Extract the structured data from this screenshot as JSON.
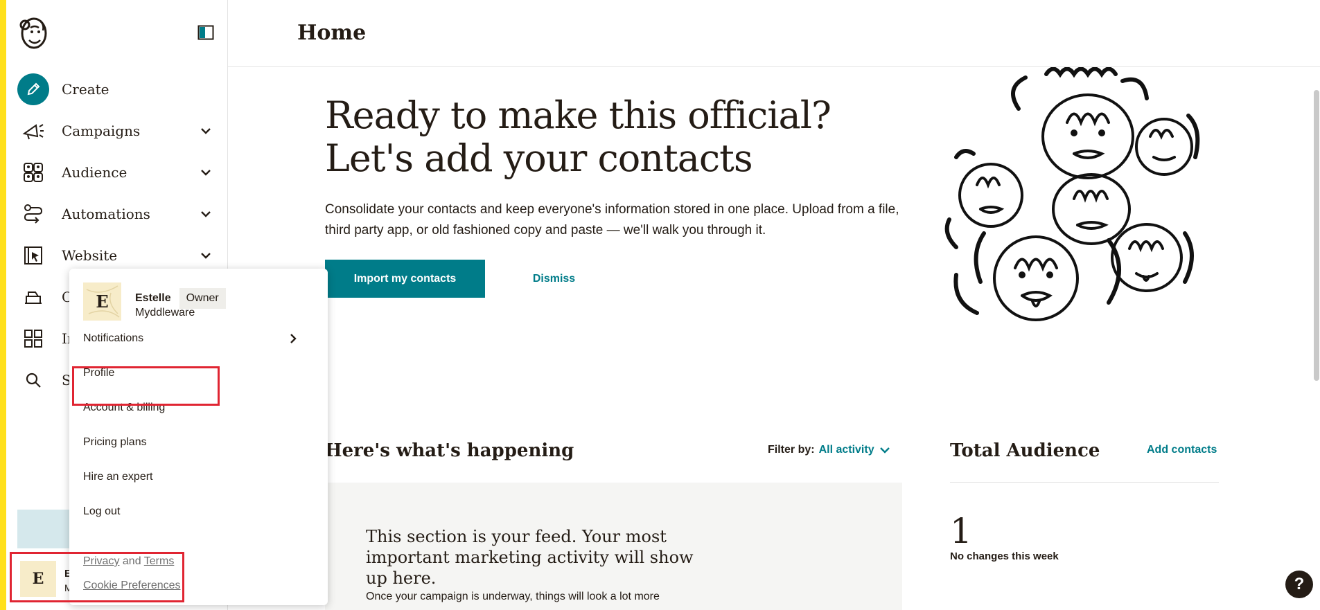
{
  "colors": {
    "accent": "#007c89",
    "brand_yellow": "#ffe01b",
    "highlight_red": "#e02532",
    "text": "#241c15"
  },
  "sidebar": {
    "logo": "mailchimp-freddie-icon",
    "collapse": "sidebar-toggle-icon",
    "items": [
      {
        "label": "Create",
        "icon": "pencil-icon",
        "has_chevron": false
      },
      {
        "label": "Campaigns",
        "icon": "megaphone-icon",
        "has_chevron": true
      },
      {
        "label": "Audience",
        "icon": "audience-icon",
        "has_chevron": true
      },
      {
        "label": "Automations",
        "icon": "automations-icon",
        "has_chevron": true
      },
      {
        "label": "Website",
        "icon": "website-cursor-icon",
        "has_chevron": true
      },
      {
        "label": "C",
        "icon": "content-icon",
        "has_chevron": false
      },
      {
        "label": "In",
        "icon": "integrations-grid-icon",
        "has_chevron": false
      },
      {
        "label": "S",
        "icon": "search-icon",
        "has_chevron": false
      }
    ],
    "user": {
      "initial": "E",
      "name_trunc": "E",
      "org_trunc": "M"
    }
  },
  "header": {
    "title": "Home"
  },
  "hero": {
    "title_line1": "Ready to make this official?",
    "title_line2": "Let's add your contacts",
    "description": "Consolidate your contacts and keep everyone's information stored in one place. Upload from a file, third party app, or old fashioned copy and paste — we'll walk you through it.",
    "import_button": "Import my contacts",
    "dismiss_button": "Dismiss"
  },
  "feed": {
    "heading": "Here's what's happening",
    "filter_label": "Filter by:",
    "filter_value": "All activity",
    "message": "This section is your feed. Your most important marketing activity will show up here.",
    "sub": "Once your campaign is underway, things will look a lot more"
  },
  "audience": {
    "title": "Total Audience",
    "add_contacts": "Add contacts",
    "count": "1",
    "change": "No changes this week"
  },
  "account_menu": {
    "initial": "E",
    "name": "Estelle",
    "role": "Owner",
    "org": "Myddleware",
    "items": [
      {
        "label": "Notifications",
        "has_arrow": true
      },
      {
        "label": "Profile",
        "has_arrow": false
      },
      {
        "label": "Account & billing",
        "has_arrow": false
      },
      {
        "label": "Pricing plans",
        "has_arrow": false
      },
      {
        "label": "Hire an expert",
        "has_arrow": false
      },
      {
        "label": "Log out",
        "has_arrow": false
      }
    ],
    "privacy": "Privacy",
    "and": "and",
    "terms": "Terms",
    "cookie": "Cookie Preferences"
  },
  "help": {
    "label": "?"
  }
}
